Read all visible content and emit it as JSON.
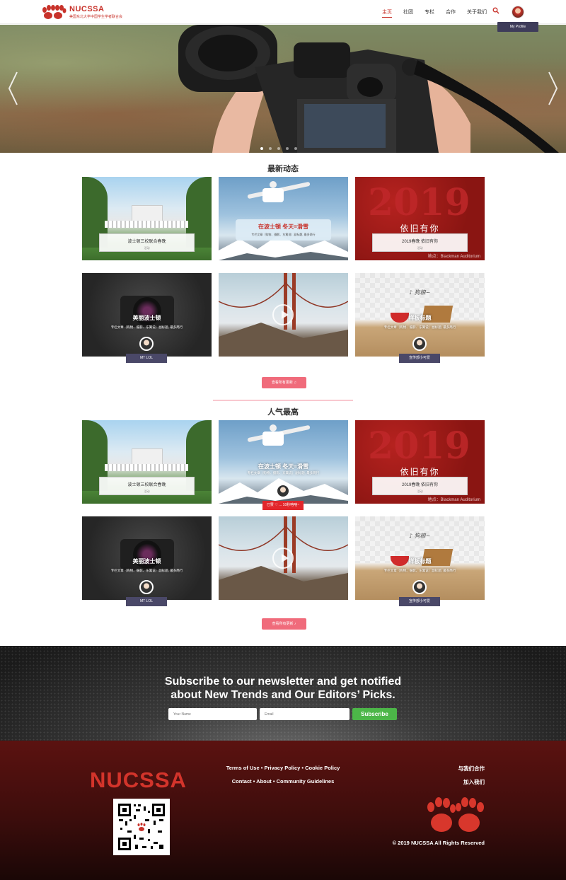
{
  "nav": {
    "brand": "NUCSSA",
    "brand_sub": "美国东北大学中国学生学者联合会",
    "menu": [
      "主页",
      "社团",
      "专栏",
      "合作",
      "关于我们"
    ],
    "active_index": 0,
    "profile_tip": "My Profile"
  },
  "hero": {
    "dots": 5,
    "active_dot": 0
  },
  "latest": {
    "title": "最新动态",
    "more_label": "查看所有更新 ♫",
    "cards": [
      {
        "title": "波士顿三校联合春晚",
        "sub": "活动",
        "bg": "campus",
        "style": "label"
      },
      {
        "title": "在波士顿 冬天=滑雪",
        "sub": "专栏文章（购物、摄影、东篱说）副标题, 最多两行",
        "bg": "snow",
        "style": "snow-label"
      },
      {
        "title": "2019春晚 依旧有你",
        "sub": "活动",
        "bg": "red",
        "style": "label"
      },
      {
        "title": "美丽波士顿",
        "sub": "专栏文章（购物、摄影、东篱说）副标题, 最多两行",
        "bg": "camera",
        "style": "center",
        "badge": "MT LOL"
      },
      {
        "title": "",
        "sub": "",
        "bg": "bridge",
        "style": "video"
      },
      {
        "title": "样板标题",
        "sub": "专栏文章（购物、摄影、东篱说）副标题, 最多两行",
        "bg": "food",
        "style": "center",
        "badge": "宣传部小可爱"
      }
    ]
  },
  "popular": {
    "title": "人气最高",
    "more_label": "查看所有更新 ♪",
    "cards": [
      {
        "title": "波士顿三校联合春晚",
        "sub": "活动",
        "bg": "campus",
        "style": "label"
      },
      {
        "title": "在波士顿 冬天=滑雪",
        "sub": "专栏文章（购物、摄影、东篱说）副标题, 最多两行",
        "bg": "snow",
        "style": "center",
        "badge": "已赞 ♡ ... 10秒咯咯~",
        "badge_red": true
      },
      {
        "title": "2019春晚 依旧有你",
        "sub": "活动",
        "bg": "red",
        "style": "label"
      },
      {
        "title": "美丽波士顿",
        "sub": "专栏文章（购物、摄影、东篱说）副标题, 最多两行",
        "bg": "camera",
        "style": "center",
        "badge": "MT LOL"
      },
      {
        "title": "",
        "sub": "",
        "bg": "bridge",
        "style": "video"
      },
      {
        "title": "样板标题",
        "sub": "专栏文章（购物、摄影、东篱说）副标题, 最多两行",
        "bg": "food",
        "style": "center",
        "badge": "宣传部小可爱"
      }
    ]
  },
  "card_overlays": {
    "snow_text": "在波士顿 冬天=滑雪",
    "red_big": "依旧有你",
    "red_caption": "地点：Blackman Auditorium",
    "food_handwriting": "♪ 狗粮~"
  },
  "newsletter": {
    "title_line1": "Subscribe to our newsletter and get notified",
    "title_line2": "about New Trends and Our Editors’ Picks.",
    "name_placeholder": "Your Name",
    "email_placeholder": "Email",
    "button": "Subscribe"
  },
  "footer": {
    "brand": "NUCSSA",
    "links_row1": "Terms of Use • Privacy Policy • Cookie Policy",
    "links_row2": "Contact • About • Community Guidelines",
    "right_1": "与我们合作",
    "right_2": "加入我们",
    "copyright": "© 2019 NUCSSA All Rights Reserved"
  },
  "colors": {
    "brand_red": "#c8322a",
    "accent_pink": "#f06b7b",
    "badge": "#4a4868",
    "subscribe_green": "#4cb648"
  }
}
